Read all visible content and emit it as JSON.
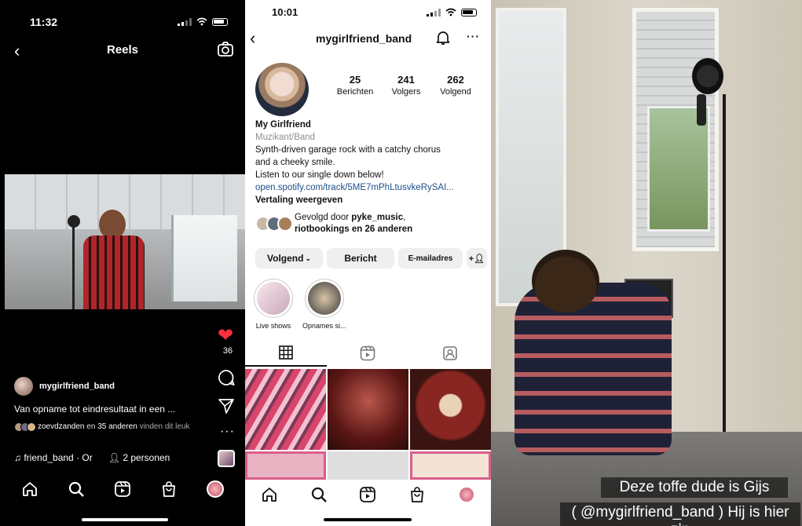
{
  "reels": {
    "time": "11:32",
    "title": "Reels",
    "like_count": "36",
    "author": "mygirlfriend_band",
    "caption": "Van opname tot eindresultaat in een ...",
    "likers_names": "zoevdzanden",
    "likers_mid": "en",
    "likers_others": "35 anderen",
    "likers_suffix": "vinden dit leuk",
    "audio": "friend_band · Or",
    "people": "2 personen",
    "icons": {
      "back": "chevron-left-icon",
      "camera": "camera-icon",
      "heart": "heart-icon",
      "comment": "comment-icon",
      "share": "send-icon",
      "more": "more-icon",
      "note": "music-note-icon",
      "person": "person-icon"
    }
  },
  "profile": {
    "time": "10:01",
    "handle": "mygirlfriend_band",
    "stats": [
      {
        "number": "25",
        "label": "Berichten"
      },
      {
        "number": "241",
        "label": "Volgers"
      },
      {
        "number": "262",
        "label": "Volgend"
      }
    ],
    "name": "My Girlfriend",
    "category": "Muzikant/Band",
    "bio_line1": "Synth-driven garage rock with a catchy chorus",
    "bio_line2": "and a cheeky smile.",
    "bio_line3": "Listen to our single down below!",
    "link": "open.spotify.com/track/5ME7mPhLtusvkeRySAI...",
    "translate": "Vertaling weergeven",
    "followed_prefix": "Gevolgd door",
    "followed_by_1": "pyke_music",
    "followed_by_2": "riotbookings",
    "followed_suffix": "en 26 anderen",
    "buttons": {
      "following": "Volgend",
      "message": "Bericht",
      "email": "E-mailadres"
    },
    "highlights": [
      {
        "label": "Live shows"
      },
      {
        "label": "Opnames si..."
      }
    ]
  },
  "story": {
    "caption_line1": "Deze toffe dude is Gijs",
    "caption_line2": "( @mygirlfriend_band ) Hij is hier z’n"
  },
  "colors": {
    "like_red": "#ff3040",
    "link_blue": "#1d4f8a",
    "dark_bg": "#000000"
  }
}
